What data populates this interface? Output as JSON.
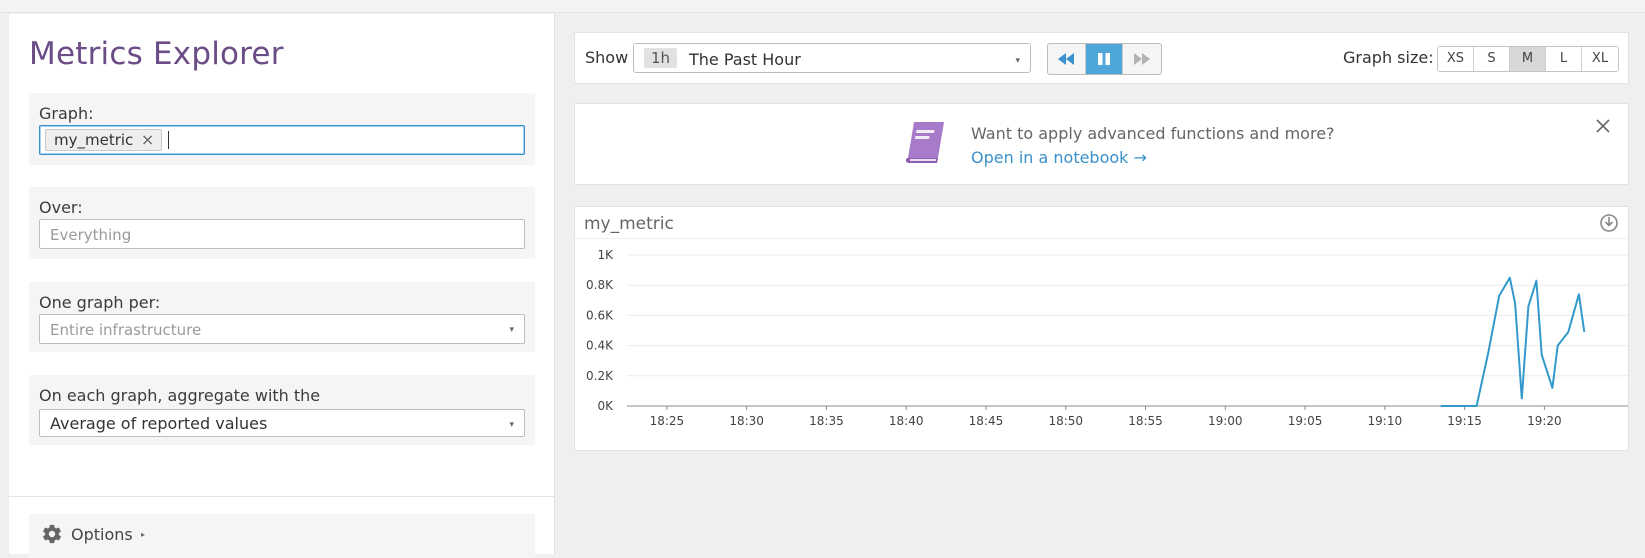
{
  "left": {
    "title": "Metrics Explorer",
    "graph": {
      "label": "Graph:",
      "tag": "my_metric",
      "tag_remove": "×"
    },
    "over": {
      "label": "Over:",
      "placeholder": "Everything"
    },
    "per": {
      "label": "One graph per:",
      "placeholder": "Entire infrastructure"
    },
    "aggregate": {
      "label": "On each graph, aggregate with the",
      "value": "Average of reported values"
    },
    "options": {
      "label": "Options",
      "caret": "▸"
    }
  },
  "toolbar": {
    "show_label": "Show",
    "time_badge": "1h",
    "time_label": "The Past Hour",
    "dropdown_arrow": "▾",
    "playback": [
      "rewind",
      "pause",
      "fast-forward"
    ],
    "playback_active": "pause",
    "size_label": "Graph size:",
    "sizes": [
      "XS",
      "S",
      "M",
      "L",
      "XL"
    ],
    "size_active": "M",
    "accent_color": "#4ea6db"
  },
  "banner": {
    "text": "Want to apply advanced functions and more?",
    "link": "Open in a notebook →",
    "icon": "notebook-icon",
    "icon_color": "#a77bca"
  },
  "graph": {
    "title": "my_metric",
    "line_color": "#3399cc"
  },
  "chart_data": {
    "type": "line",
    "title": "my_metric",
    "xlabel": "",
    "ylabel": "",
    "x_ticks": [
      "18:25",
      "18:30",
      "18:35",
      "18:40",
      "18:45",
      "18:50",
      "18:55",
      "19:00",
      "19:05",
      "19:10",
      "19:15",
      "19:20"
    ],
    "y_ticks": [
      "0K",
      "0.2K",
      "0.4K",
      "0.6K",
      "0.8K",
      "1K"
    ],
    "ylim": [
      0,
      1000
    ],
    "grid": true,
    "series": [
      {
        "x": [
          "19:13:30",
          "19:15:45",
          "19:16:30",
          "19:17:10",
          "19:17:50",
          "19:18:10",
          "19:18:35",
          "19:19:00",
          "19:19:30",
          "19:19:50",
          "19:20:30",
          "19:20:50",
          "19:21:30",
          "19:22:10",
          "19:22:30"
        ],
        "values": [
          0,
          0,
          360,
          730,
          850,
          680,
          50,
          660,
          830,
          340,
          120,
          400,
          490,
          740,
          490
        ]
      }
    ]
  }
}
